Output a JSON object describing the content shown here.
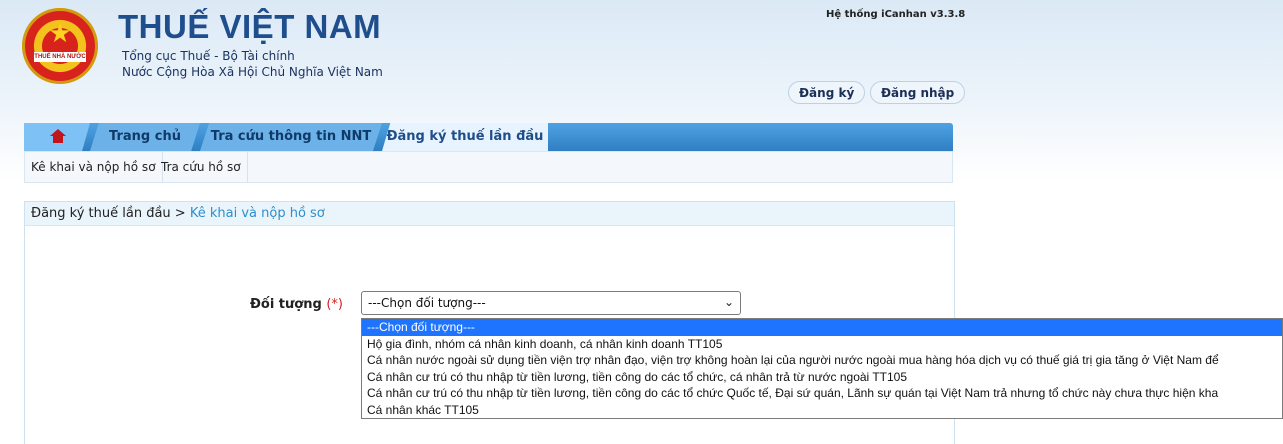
{
  "header": {
    "logo_text": "THUẾ NHÀ NƯỚC",
    "title": "THUẾ VIỆT NAM",
    "subtitle1": "Tổng cục Thuế - Bộ Tài chính",
    "subtitle2": "Nước Cộng Hòa Xã Hội Chủ Nghĩa Việt Nam",
    "version": "Hệ thống iCanhan v3.3.8",
    "register_label": "Đăng ký",
    "login_label": "Đăng nhập"
  },
  "nav": {
    "home_icon": "home-icon",
    "tabs": [
      {
        "label": "Trang chủ"
      },
      {
        "label": "Tra cứu thông tin NNT"
      },
      {
        "label": "Đăng ký thuế lần đầu"
      }
    ]
  },
  "subnav": {
    "items": [
      {
        "label": "Kê khai và nộp hồ sơ"
      },
      {
        "label": "Tra cứu hồ sơ"
      }
    ]
  },
  "content": {
    "breadcrumb_prefix": "Đăng ký thuế lần đầu >",
    "breadcrumb_active": "Kê khai và nộp hồ sơ",
    "field_label": "Đối tượng",
    "required_mark": "(*)",
    "select_value": "---Chọn đối tượng---",
    "dropdown_options": [
      "---Chọn đối tượng---",
      "Hộ gia đình, nhóm cá nhân kinh doanh, cá nhân kinh doanh TT105",
      "Cá nhân nước ngoài sử dụng tiền viện trợ nhân đạo, viện trợ không hoàn lại của người nước ngoài mua hàng hóa dịch vụ có thuế giá trị gia tăng ở Việt Nam để",
      "Cá nhân cư trú có thu nhập từ tiền lương, tiền công do các tổ chức, cá nhân trả từ nước ngoài TT105",
      "Cá nhân cư trú có thu nhập từ tiền lương, tiền công do các tổ chức Quốc tế, Đại sứ quán, Lãnh sự quán tại Việt Nam trả nhưng tổ chức này chưa thực hiện kha",
      "Cá nhân khác TT105"
    ]
  }
}
